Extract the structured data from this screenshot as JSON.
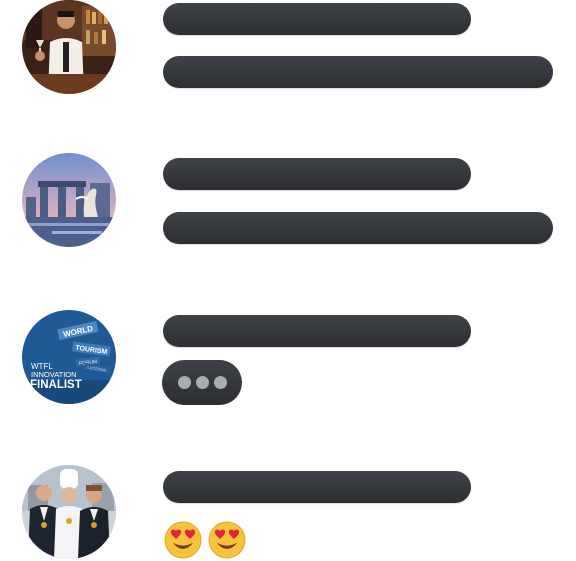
{
  "messages": [
    {
      "avatar": "bartender-photo",
      "content": "two-text-placeholders"
    },
    {
      "avatar": "singapore-skyline-photo",
      "content": "two-text-placeholders"
    },
    {
      "avatar": "wtfl-badge",
      "avatar_text": {
        "line1": "WTFL",
        "line2": "INNOVATION",
        "line3": "FINALIST",
        "sign1": "WORLD",
        "sign2": "TOURISM",
        "sign3": "FORUM",
        "sign4": "LUCERNE"
      },
      "content": "typing-indicator"
    },
    {
      "avatar": "chefs-group-photo",
      "content": "emoji-reaction",
      "emojis": [
        "heart-eyes-emoji",
        "heart-eyes-emoji"
      ]
    }
  ],
  "colors": {
    "bubble": "#35383c",
    "typing_dot": "#a9acb2",
    "badge_blue": "#1f5a94",
    "emoji_yellow": "#f7c33c",
    "heart_red": "#e0243c"
  }
}
